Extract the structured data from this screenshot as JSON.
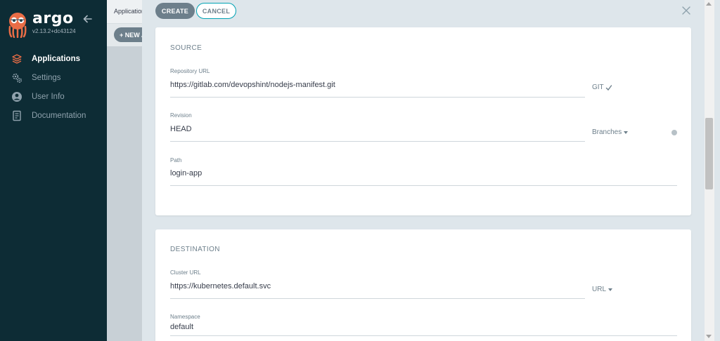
{
  "sidebar": {
    "brand": "argo",
    "version": "v2.13.2+dc43124",
    "items": [
      {
        "label": "Applications",
        "icon": "layers-icon",
        "active": true
      },
      {
        "label": "Settings",
        "icon": "gears-icon",
        "active": false
      },
      {
        "label": "User Info",
        "icon": "user-circle-icon",
        "active": false
      },
      {
        "label": "Documentation",
        "icon": "book-icon",
        "active": false
      }
    ]
  },
  "background_page": {
    "header_title": "Applications",
    "new_app_label": "+ NEW APP"
  },
  "panel": {
    "create_label": "CREATE",
    "cancel_label": "CANCEL",
    "source": {
      "title": "SOURCE",
      "repo_url_label": "Repository URL",
      "repo_url_value": "https://gitlab.com/devopshint/nodejs-manifest.git",
      "repo_type": "GIT",
      "revision_label": "Revision",
      "revision_value": "HEAD",
      "revision_mode": "Branches",
      "path_label": "Path",
      "path_value": "login-app"
    },
    "destination": {
      "title": "DESTINATION",
      "cluster_url_label": "Cluster URL",
      "cluster_url_value": "https://kubernetes.default.svc",
      "cluster_mode": "URL",
      "namespace_label": "Namespace",
      "namespace_value": "default"
    }
  },
  "colors": {
    "sidebar_bg": "#0d2c35",
    "primary_button": "#6d7f8b",
    "accent": "#00a2b3",
    "logo_orange": "#e96d46"
  }
}
